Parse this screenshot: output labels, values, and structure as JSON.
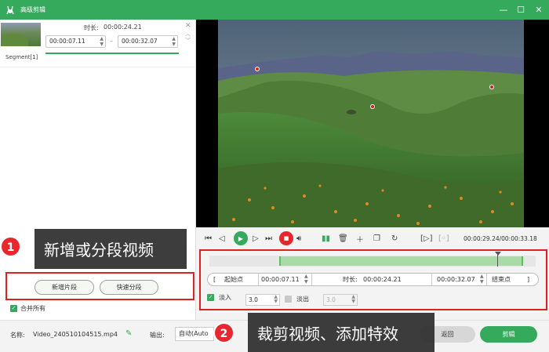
{
  "window": {
    "title": "高级剪辑",
    "min": "—",
    "max": "☐",
    "close": "✕"
  },
  "segment": {
    "label": "Segment[1]",
    "duration_label": "时长:",
    "duration_value": "00:00:24.21",
    "start": "00:00:07.11",
    "end": "00:00:32.07",
    "dash": "–"
  },
  "left_buttons": {
    "new_clip": "新增片段",
    "quick_split": "快速分段"
  },
  "merge": {
    "label": "合并所有",
    "checked": true
  },
  "callout1": {
    "number": "1",
    "text": "新增或分段视频"
  },
  "callout2": {
    "number": "2",
    "text": "裁剪视频、添加特效"
  },
  "player": {
    "current": "00:00:29.24",
    "total": "00:00:33.18",
    "timecode": "00:00:29.24/00:00:33.18",
    "markers": [
      "1",
      "2",
      "3"
    ]
  },
  "trim": {
    "start_label": "起始点",
    "start_value": "00:00:07.11",
    "duration_label": "时长:",
    "duration_value": "00:00:24.21",
    "end_value": "00:00:32.07",
    "end_label": "结束点",
    "open_bracket": "[",
    "close_bracket": "]"
  },
  "fade": {
    "fade_in_label": "淡入",
    "fade_in_value": "3.0",
    "fade_in_checked": true,
    "fade_out_label": "淡出",
    "fade_out_value": "3.0",
    "fade_out_checked": false
  },
  "bottom": {
    "name_label": "名称:",
    "name_value": "Video_240510104515.mp4",
    "output_label": "输出:",
    "output_value": "自动(Auto",
    "return_label": "返回",
    "cut_label": "剪辑"
  },
  "colors": {
    "accent": "#35a95c",
    "danger": "#e8262e",
    "callout_bg": "#2d2d2d"
  }
}
